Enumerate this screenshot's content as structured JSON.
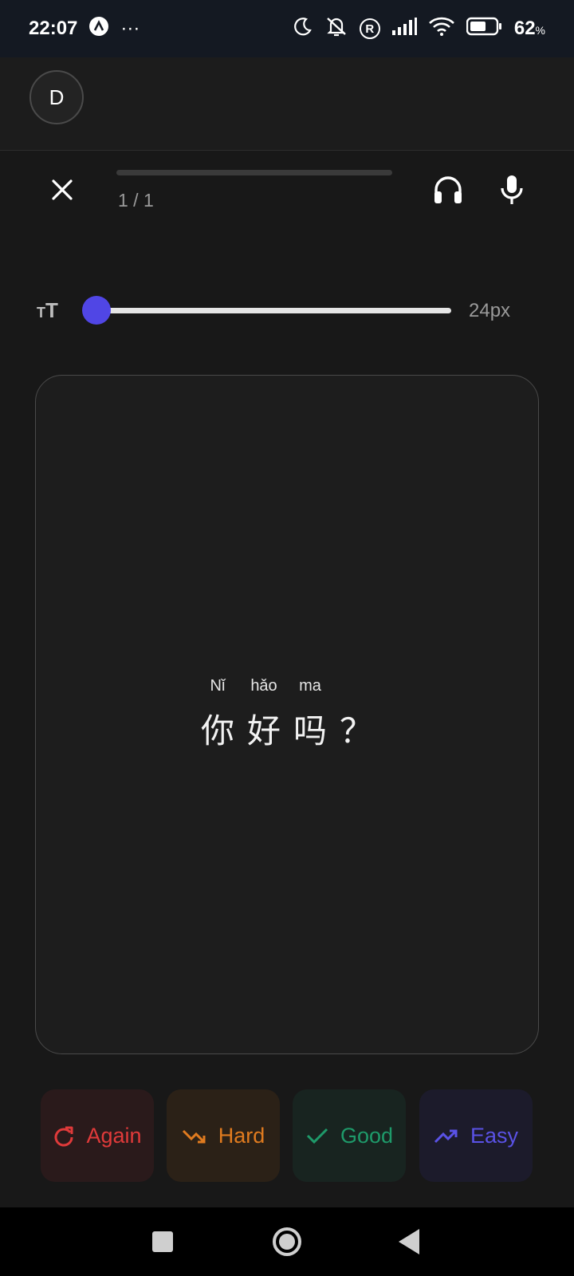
{
  "status_bar": {
    "time": "22:07",
    "more": "···",
    "registered_symbol": "R",
    "battery_percent": "62",
    "battery_unit": "%",
    "battery_level": 0.62
  },
  "header": {
    "avatar_initial": "D"
  },
  "session": {
    "progress_text": "1 / 1",
    "progress_fraction": 0.0
  },
  "font_size": {
    "icon_small": "T",
    "icon_large": "T",
    "value_label": "24px",
    "slider_fraction": 0.0
  },
  "card": {
    "words": [
      {
        "pinyin": "Nǐ",
        "hanzi": "你"
      },
      {
        "pinyin": "hǎo",
        "hanzi": "好"
      },
      {
        "pinyin": "ma",
        "hanzi": "吗"
      },
      {
        "pinyin": "",
        "hanzi": "？"
      }
    ]
  },
  "ratings": {
    "again": {
      "label": "Again",
      "color": "#e03a3a"
    },
    "hard": {
      "label": "Hard",
      "color": "#e07b1f"
    },
    "good": {
      "label": "Good",
      "color": "#1e9a6a"
    },
    "easy": {
      "label": "Easy",
      "color": "#5a52e6"
    }
  },
  "colors": {
    "accent": "#5046e5",
    "background": "#181818"
  }
}
